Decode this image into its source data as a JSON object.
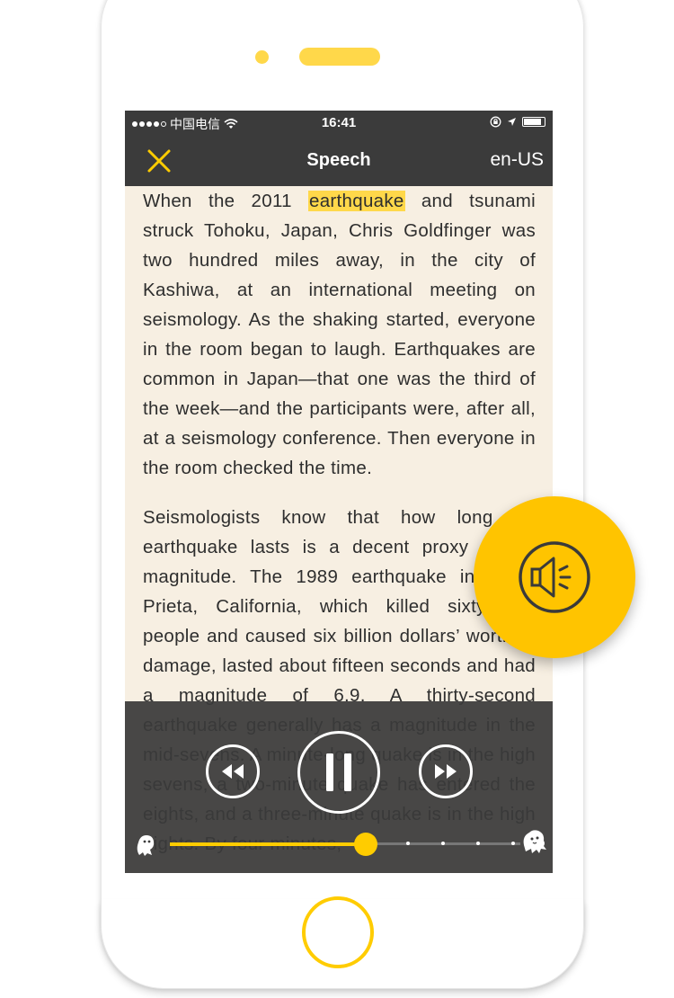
{
  "status_bar": {
    "carrier": "中国电信",
    "time": "16:41"
  },
  "nav": {
    "title": "Speech",
    "language": "en-US",
    "close_icon": "close-icon"
  },
  "article": {
    "highlighted_word": "earthquake",
    "p1_before": "When the 2011 ",
    "p1_after": " and tsunami struck Tohoku, Japan, Chris Goldfinger was two hundred miles away, in the city of Kashiwa, at an international meeting on seismology. As the shaking started, everyone in the room began to laugh. Earthquakes are common in Japan—that one was the third of the week—and the participants were, after all, at a seismology conference. Then everyone in the room checked the time.",
    "p2": "Seismologists know that how long an earthquake lasts is a decent proxy for its magnitude. The 1989 earthquake in Loma Prieta, California, which killed sixty-three people and caused six billion dollars’ worth of damage, lasted about fifteen seconds and had a magnitude of 6.9. A thirty-second earthquake generally has a magnitude in the mid-sevens. A minute-long quake is in the high sevens, a two-minute quake has entered the eights, and a three-minute quake is in the high eights. By four minutes,"
  },
  "player": {
    "state": "playing",
    "progress": 0.56,
    "ticks": [
      0.68,
      0.78,
      0.88,
      0.98
    ],
    "controls": {
      "rewind": "rewind-icon",
      "pause": "pause-icon",
      "fast_forward": "fast-forward-icon"
    }
  },
  "fab": {
    "icon": "speaker-icon"
  },
  "colors": {
    "accent": "#ffcc00",
    "bar": "#3b3b3b",
    "paper": "#f7efe2",
    "text": "#2e2e2e"
  }
}
